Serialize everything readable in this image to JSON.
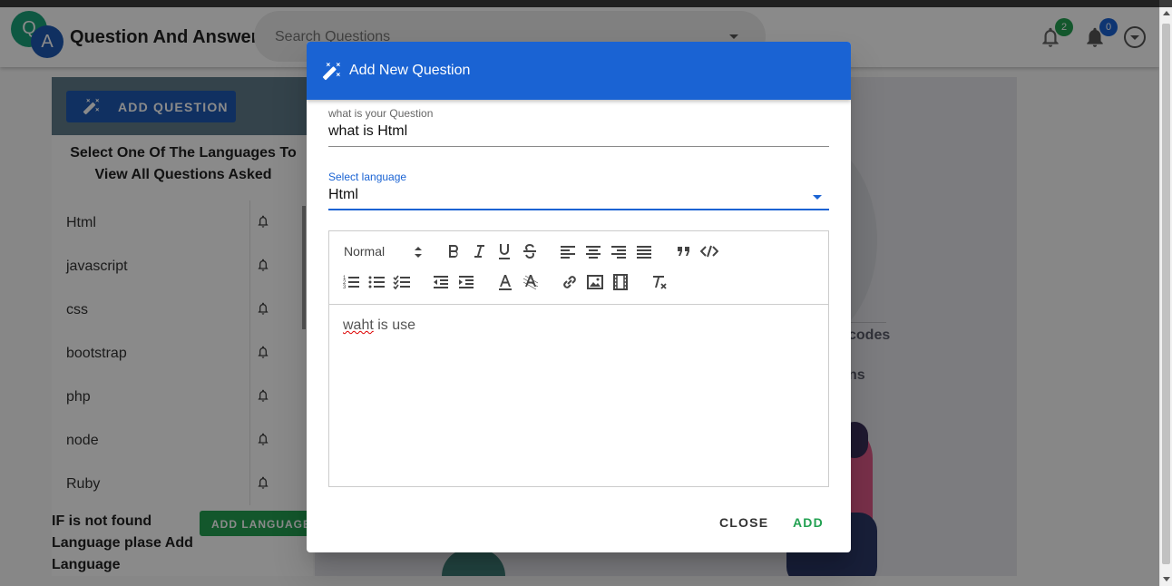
{
  "app": {
    "title": "Question And Answer",
    "logo_letters": [
      "Q",
      "A"
    ]
  },
  "search": {
    "placeholder": "Search Questions"
  },
  "notifications": [
    {
      "icon": "bell-icon",
      "count": "2",
      "color": "#23a152"
    },
    {
      "icon": "bell-icon",
      "count": "0",
      "color": "#1a63d3"
    }
  ],
  "sidebar": {
    "add_question_label": "ADD QUESTION",
    "heading": "Select One Of The Languages To View All Questions Asked",
    "languages": [
      "Html",
      "javascript",
      "css",
      "bootstrap",
      "php",
      "node",
      "Ruby"
    ],
    "footer_text": "IF is not found Language plase Add Language",
    "add_language_label": "ADD LANGUAGE"
  },
  "background": {
    "text1": "codes",
    "text2": "ns"
  },
  "dialog": {
    "title": "Add New Question",
    "question_label": "what is your Question",
    "question_value": "what is Html",
    "language_label": "Select language",
    "language_value": "Html",
    "toolbar": {
      "heading_select": "Normal"
    },
    "editor_text_misspelled": "waht",
    "editor_text_rest": " is use",
    "close_label": "CLOSE",
    "add_label": "ADD"
  },
  "colors": {
    "primary": "#1a63d3",
    "success": "#23a152",
    "sidebar_header": "#607d8b"
  }
}
